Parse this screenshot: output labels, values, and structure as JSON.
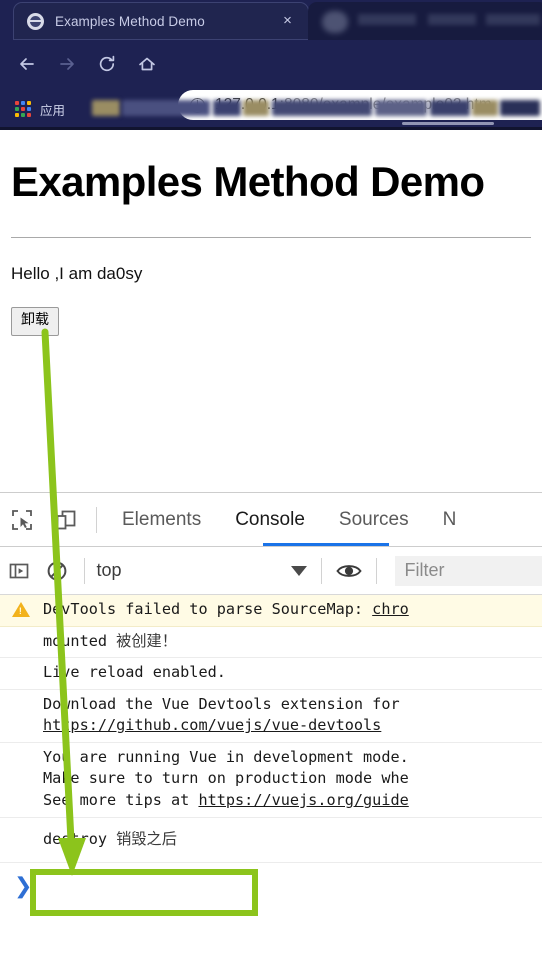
{
  "browser": {
    "tabs": [
      {
        "title": "Examples Method Demo",
        "favicon": "globe-icon",
        "active": true,
        "close_label": "×"
      },
      {
        "title": "",
        "favicon": "blurred-favicon",
        "active": false,
        "close_label": ""
      }
    ],
    "nav": {
      "back_icon": "back-arrow-icon",
      "forward_icon": "forward-arrow-icon",
      "reload_icon": "reload-icon",
      "home_icon": "home-icon",
      "back_glyph": "←",
      "forward_glyph": "→",
      "reload_glyph": "↻",
      "home_glyph": "⌂"
    },
    "omnibox": {
      "security_icon": "info-circle-icon",
      "url_prefix": "127.0.0.1",
      "url_rest": ":8080/example/example02.htm"
    },
    "bookmarks": {
      "apps_icon": "apps-grid-icon",
      "apps_label": "应用"
    },
    "theme": {
      "chrome_bg": "#1e2252",
      "tab_active_bg": "#20254f",
      "tab_text": "#c7cbe6"
    }
  },
  "page": {
    "heading": "Examples Method Demo",
    "paragraph": "Hello ,I am da0sy",
    "button_label": "卸载"
  },
  "devtools": {
    "toolbar": {
      "inspect_icon": "inspect-element-icon",
      "device_icon": "device-toolbar-icon"
    },
    "tabs": [
      {
        "label": "Elements",
        "active": false
      },
      {
        "label": "Console",
        "active": true
      },
      {
        "label": "Sources",
        "active": false
      },
      {
        "label": "N",
        "active": false
      }
    ],
    "console_toolbar": {
      "sidebar_icon": "console-sidebar-icon",
      "clear_icon": "clear-console-icon",
      "context": "top",
      "context_caret": "caret-down-icon",
      "eye_icon": "live-expression-eye-icon",
      "filter_placeholder": "Filter"
    },
    "messages": [
      {
        "type": "warning",
        "icon": "warning-triangle-icon",
        "text": "DevTools failed to parse SourceMap: ",
        "link": "chro",
        "cn": ""
      },
      {
        "type": "log",
        "text": "mounted ",
        "cn": "被创建！",
        "link": ""
      },
      {
        "type": "log",
        "text": "Live reload enabled.",
        "cn": "",
        "link": ""
      },
      {
        "type": "log",
        "text": "Download the Vue Devtools extension for ",
        "cn": "",
        "link": "https://github.com/vuejs/vue-devtools"
      },
      {
        "type": "log",
        "line1": "You are running Vue in development mode.",
        "line2": "Make sure to turn on production mode whe",
        "line3_pre": "See more tips at ",
        "line3_link": "https://vuejs.org/guide"
      },
      {
        "type": "log",
        "text": "destroy ",
        "cn": "销毁之后",
        "link": "",
        "highlighted": true
      }
    ],
    "prompt": {
      "chevron": "❯",
      "icon": "console-prompt-icon"
    }
  },
  "annotation": {
    "arrow_color": "#8cc41c",
    "highlight_color": "#8cc41c",
    "arrow_name": "green-callout-arrow",
    "highlight_name": "green-highlight-box"
  }
}
